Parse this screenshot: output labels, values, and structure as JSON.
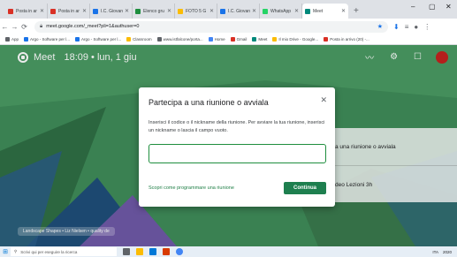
{
  "browser": {
    "tabs": [
      {
        "label": "Posta in ar",
        "icon": "gmail-icon",
        "color": "#d93025",
        "active": false
      },
      {
        "label": "Posta in ar",
        "icon": "gmail-icon",
        "color": "#d93025",
        "active": false
      },
      {
        "label": "I.C. Giovan",
        "icon": "school-icon",
        "color": "#1a73e8",
        "active": false
      },
      {
        "label": "Elenco gru",
        "icon": "classroom-icon",
        "color": "#1e8e3e",
        "active": false
      },
      {
        "label": "FOTO 5 G",
        "icon": "drive-icon",
        "color": "#fbbc04",
        "active": false
      },
      {
        "label": "I.C. Giovan",
        "icon": "school-icon",
        "color": "#1a73e8",
        "active": false
      },
      {
        "label": "WhatsApp",
        "icon": "whatsapp-icon",
        "color": "#25d366",
        "active": false
      },
      {
        "label": "Meet",
        "icon": "meet-icon",
        "color": "#00897b",
        "active": true
      }
    ],
    "url": "meet.google.com/_meet?pli=1&authuser=0",
    "bookmarks": [
      {
        "label": "App",
        "color": "#5f6368"
      },
      {
        "label": "Argo - Software per l...",
        "color": "#1a73e8"
      },
      {
        "label": "Argo - Software per l...",
        "color": "#1a73e8"
      },
      {
        "label": "Classroom",
        "color": "#fbbc04"
      },
      {
        "label": "www.istfalcone/porta...",
        "color": "#5f6368"
      },
      {
        "label": "Home",
        "color": "#4285f4"
      },
      {
        "label": "Gmail",
        "color": "#d93025"
      },
      {
        "label": "Meet",
        "color": "#00897b"
      },
      {
        "label": "Il mio Drive - Google...",
        "color": "#fbbc04"
      },
      {
        "label": "Posta in arrivo (20) -...",
        "color": "#d93025"
      }
    ]
  },
  "meet": {
    "app_name": "Meet",
    "time_date": "18:09 • lun, 1 giu",
    "card_rows": [
      "a una riunione o avviala",
      "deo Lezioni 3h"
    ],
    "wallpaper_label": "Landscape Shapes • Liz Nielsen • quality de"
  },
  "dialog": {
    "title": "Partecipa a una riunione o avviala",
    "description": "Inserisci il codice o il nickname della riunione. Per avviare la tua riunione, inserisci un nickname o lascia il campo vuoto.",
    "input_value": "",
    "link": "Scopri come programmare una riunione",
    "button": "Continua"
  },
  "taskbar": {
    "search_placeholder": "Scrivi qui per eseguire la ricerca",
    "tray": [
      "ITA",
      "2020"
    ]
  },
  "colors": {
    "meet_green": "#3f8c59",
    "primary_button": "#1e7f4f",
    "avatar": "#c5221f"
  }
}
